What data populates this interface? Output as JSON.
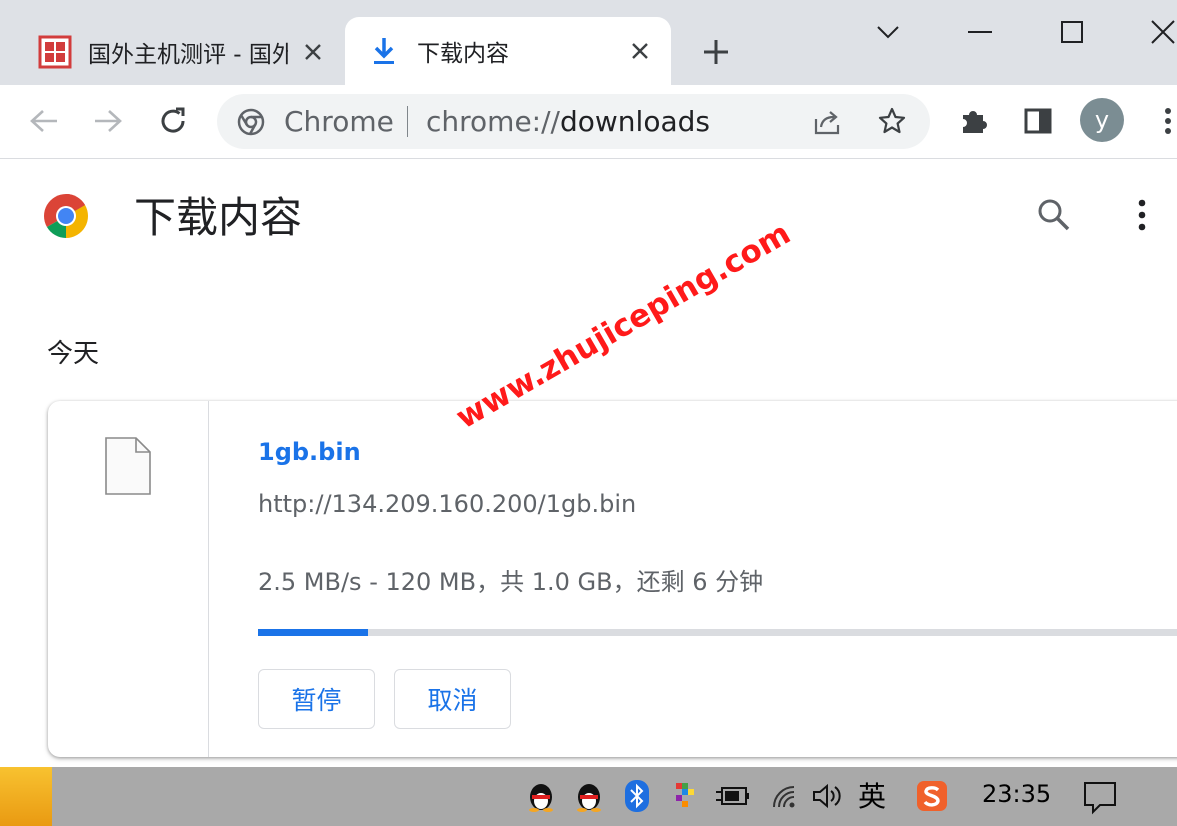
{
  "tabs": [
    {
      "title": "国外主机测评 - 国外",
      "active": false,
      "favicon": "site-seal-icon"
    },
    {
      "title": "下载内容",
      "active": true,
      "favicon": "download-icon"
    }
  ],
  "omnibox": {
    "chip": "Chrome",
    "url_scheme": "chrome://",
    "url_path": "downloads"
  },
  "profile": {
    "initial": "y"
  },
  "page": {
    "title": "下载内容",
    "date_group": "今天"
  },
  "download": {
    "file_name": "1gb.bin",
    "url": "http://134.209.160.200/1gb.bin",
    "status": "2.5 MB/s - 120 MB，共 1.0 GB，还剩 6 分钟",
    "progress": 0.115,
    "pause_label": "暂停",
    "cancel_label": "取消"
  },
  "watermark": "www.zhujiceping.com",
  "taskbar": {
    "ime": "英",
    "clock": "23:35"
  },
  "colors": {
    "accent": "#1a73e8",
    "tabstrip": "#dee1e6",
    "taskbar": "#a9a9a9",
    "watermark": "#ff1a1a"
  }
}
